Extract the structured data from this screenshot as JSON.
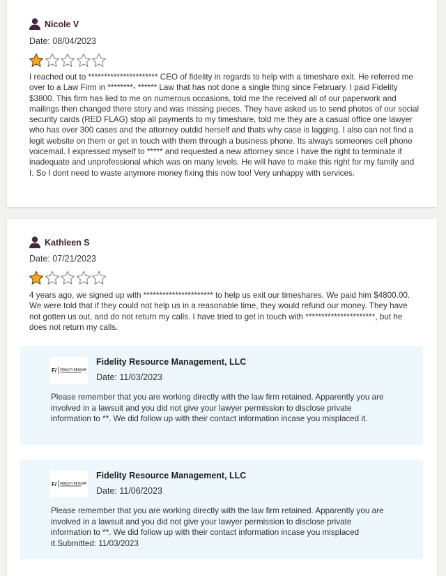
{
  "reviews": [
    {
      "reviewer_name": "Nicole V",
      "date": "Date: 08/04/2023",
      "rating": 1,
      "max_rating": 5,
      "text": "I reached out to ********************** CEO of fidelity in regards to help with a timeshare exit. He referred me over to a Law Firm in ********- ****** Law that has not done a single thing since February. I paid Fidelity $3800. This firm has lied to me on numerous occasions, told me the received all of our paperwork and mailings then changed there story and was missing pieces. They have asked us to send photos of our social security cards (RED FLAG) stop all payments to my timeshare, told me they are a casual office one lawyer who has over 300 cases and the attorney outdid herself and thats why case is lagging. I also can not find a legit website on them or get in touch with them through a business phone. Its always someones cell phone voicemail. I expressed myself to ***** and requested a new attorney since I have the right to terminate if inadequate and unprofessional which was on many levels. He will have to make this right for my family and I. So I dont need to waste anymore money fixing this now too! Very unhappy with services."
    },
    {
      "reviewer_name": "Kathleen S",
      "date": "Date: 07/21/2023",
      "rating": 1,
      "max_rating": 5,
      "text": "4 years ago, we signed up with ********************** to help us exit our timeshares. We paid him $4800.00. We were told that if they could not help us in a reasonable time, they would refund our money. They have not gotten us out, and do not return my calls. I have tried to get in touch with **********************, but he does not return my calls.",
      "responses": [
        {
          "business_name": "Fidelity Resource Management, LLC",
          "date": "Date: 11/03/2023",
          "text": "Please remember that you are working directly with the law firm retained. Apparently you are involved in a lawsuit and you did not give your lawyer permission to disclose private information to **. We did follow up with their contact information incase you misplaced it."
        },
        {
          "business_name": "Fidelity Resource Management, LLC",
          "date": "Date: 11/06/2023",
          "text": "Please remember that you are working directly with the law firm retained. Apparently you are involved in a lawsuit and you did not give your lawyer permission to disclose private information to **. We did follow up with their contact information incase you misplaced it.Submitted: 11/03/2023"
        }
      ]
    }
  ],
  "logo_text": "FIDELITY RESOURCE",
  "colors": {
    "reviewer_icon": "#4a2540",
    "star_fill": "#f5a623",
    "star_outline": "#8c8c8c",
    "response_bg": "#eef7fb",
    "card_bg": "#ffffff",
    "page_bg": "#f3f2f0"
  }
}
